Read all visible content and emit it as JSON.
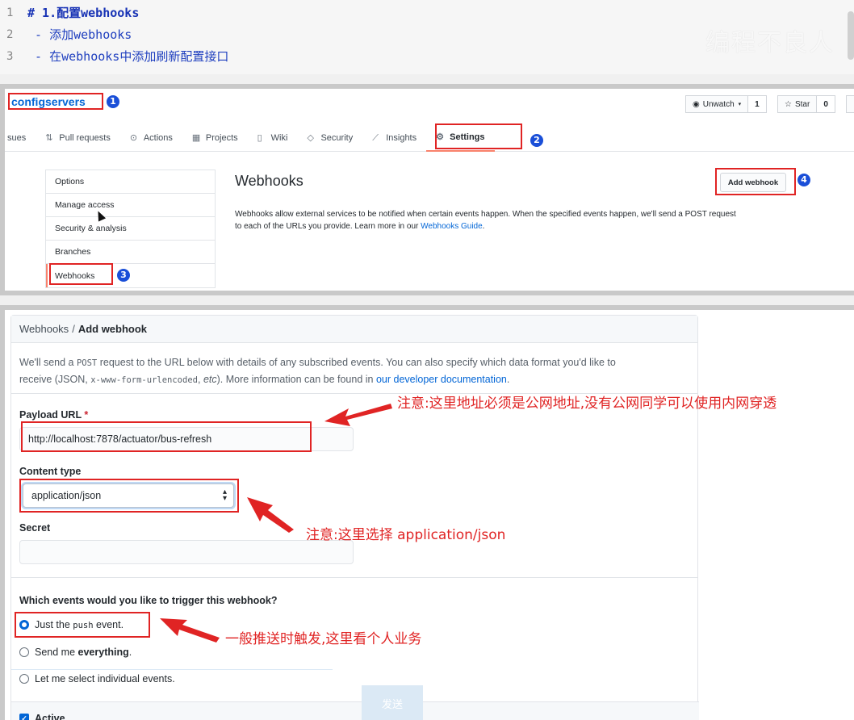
{
  "editor": {
    "lines": [
      {
        "number": "1",
        "text": "# 1.配置webhooks"
      },
      {
        "number": "2",
        "text": " - 添加webhooks"
      },
      {
        "number": "3",
        "text": " - 在webhooks中添加刷新配置接口"
      }
    ],
    "watermark": "编程不良人"
  },
  "repo": {
    "name": "configservers",
    "watch_label": "Unwatch",
    "watch_count": "1",
    "star_label": "Star",
    "star_count": "0"
  },
  "tabs": [
    {
      "label": "sues",
      "icon": ""
    },
    {
      "label": "Pull requests",
      "icon": "pull-request-icon"
    },
    {
      "label": "Actions",
      "icon": "play-icon"
    },
    {
      "label": "Projects",
      "icon": "project-icon"
    },
    {
      "label": "Wiki",
      "icon": "book-icon"
    },
    {
      "label": "Security",
      "icon": "shield-icon"
    },
    {
      "label": "Insights",
      "icon": "graph-icon"
    },
    {
      "label": "Settings",
      "icon": "gear-icon"
    }
  ],
  "sidebar": {
    "items": [
      {
        "label": "Options"
      },
      {
        "label": "Manage access"
      },
      {
        "label": "Security & analysis"
      },
      {
        "label": "Branches"
      },
      {
        "label": "Webhooks"
      }
    ]
  },
  "webhooks_page": {
    "title": "Webhooks",
    "add_button": "Add webhook",
    "desc_1": "Webhooks allow external services to be notified when certain events happen. When the specified events happen, we'll send a POST request",
    "desc_2": "to each of the URLs you provide. Learn more in our ",
    "desc_link": "Webhooks Guide",
    "desc_end": "."
  },
  "form": {
    "breadcrumb_parent": "Webhooks",
    "breadcrumb_sep": "/",
    "breadcrumb_current": "Add webhook",
    "intro_1": "We'll send a ",
    "intro_post": "POST",
    "intro_2": " request to the URL below with details of any subscribed events. You can also specify which data format you'd like to",
    "intro_3": "receive (JSON, ",
    "intro_code": "x-www-form-urlencoded",
    "intro_4": ", ",
    "intro_etc": "etc",
    "intro_5": "). More information can be found in ",
    "intro_link": "our developer documentation",
    "intro_6": ".",
    "payload_label": "Payload URL",
    "payload_required": "*",
    "payload_value": "http://localhost:7878/actuator/bus-refresh",
    "content_type_label": "Content type",
    "content_type_value": "application/json",
    "secret_label": "Secret",
    "secret_value": "",
    "events_title": "Which events would you like to trigger this webhook?",
    "event_push_1": "Just the ",
    "event_push_code": "push",
    "event_push_2": " event.",
    "event_everything_1": "Send me ",
    "event_everything_2": "everything",
    "event_everything_3": ".",
    "event_select": "Let me select individual events.",
    "active_label": "Active",
    "send_button": "发送"
  },
  "annotations": {
    "badge_1": "1",
    "badge_2": "2",
    "badge_3": "3",
    "badge_4": "4",
    "note_payload": "注意:这里地址必须是公网地址,没有公网同学可以使用内网穿透",
    "note_content_type": "注意:这里选择 application/json",
    "note_events": "一般推送时触发,这里看个人业务",
    "color": "#e02424"
  }
}
